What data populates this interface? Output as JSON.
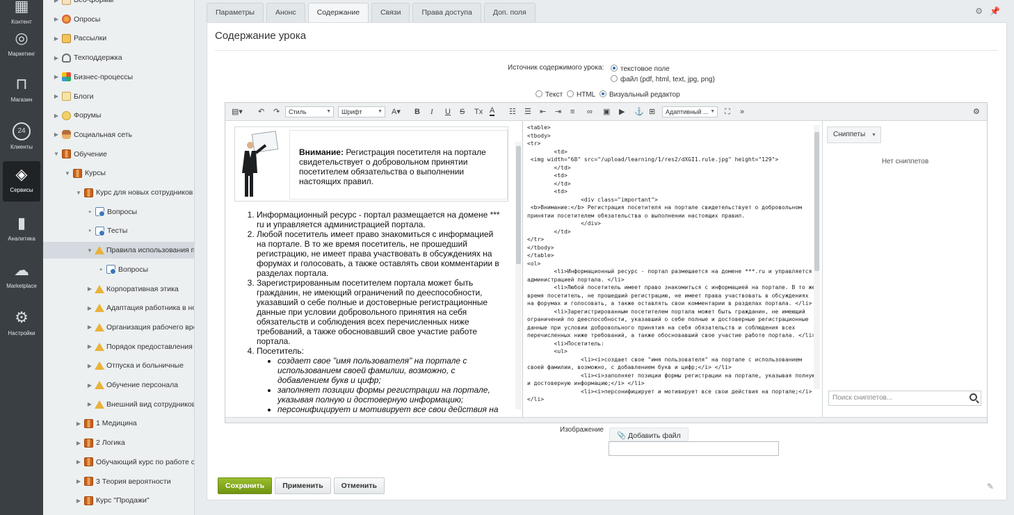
{
  "rail": [
    {
      "label": "Контент",
      "icon": "content-icon"
    },
    {
      "label": "Маркетинг",
      "icon": "target-icon"
    },
    {
      "label": "Магазин",
      "icon": "basket-icon"
    },
    {
      "label": "Клиенты",
      "icon": "clients-icon",
      "badge": "24"
    },
    {
      "label": "Сервисы",
      "icon": "layers-icon",
      "active": true
    },
    {
      "label": "Аналитика",
      "icon": "bar-chart-icon"
    },
    {
      "label": "Marketplace",
      "icon": "cloud-download-icon"
    },
    {
      "label": "Настройки",
      "icon": "gear-icon"
    }
  ],
  "tree": [
    {
      "label": "Веб-формы",
      "icon": "web",
      "level": 0
    },
    {
      "label": "Опросы",
      "icon": "round",
      "level": 0
    },
    {
      "label": "Рассылки",
      "icon": "env",
      "level": 0
    },
    {
      "label": "Техподдержка",
      "icon": "head",
      "level": 0
    },
    {
      "label": "Бизнес-процессы",
      "icon": "biz",
      "level": 0
    },
    {
      "label": "Блоги",
      "icon": "blog",
      "level": 0
    },
    {
      "label": "Форумы",
      "icon": "forum",
      "level": 0
    },
    {
      "label": "Социальная сеть",
      "icon": "social",
      "level": 0
    },
    {
      "label": "Обучение",
      "icon": "book",
      "level": 0,
      "open": true
    },
    {
      "label": "Курсы",
      "icon": "book",
      "level": 1,
      "open": true
    },
    {
      "label": "Курс для новых сотрудников",
      "icon": "book",
      "level": 2,
      "open": true
    },
    {
      "label": "Вопросы",
      "icon": "q",
      "level": 3,
      "leaf": true
    },
    {
      "label": "Тесты",
      "icon": "q",
      "level": 3,
      "leaf": true
    },
    {
      "label": "Правила использования портала",
      "icon": "warn",
      "level": 3,
      "open": true,
      "selected": true
    },
    {
      "label": "Вопросы",
      "icon": "q",
      "level": 4,
      "leaf": true
    },
    {
      "label": "Корпоративная этика",
      "icon": "warn",
      "level": 3
    },
    {
      "label": "Адаптация работника в новом коллективе",
      "icon": "warn",
      "level": 3
    },
    {
      "label": "Организация рабочего времени",
      "icon": "warn",
      "level": 3
    },
    {
      "label": "Порядок предоставления отпусков",
      "icon": "warn",
      "level": 3
    },
    {
      "label": "Отпуска и больничные",
      "icon": "warn",
      "level": 3
    },
    {
      "label": "Обучение персонала",
      "icon": "warn",
      "level": 3
    },
    {
      "label": "Внешний вид сотрудников",
      "icon": "warn",
      "level": 3
    },
    {
      "label": "1 Медицина",
      "icon": "book",
      "level": 2
    },
    {
      "label": "2 Логика",
      "icon": "book",
      "level": 2
    },
    {
      "label": "Обучающий курс по работе с порталом",
      "icon": "book",
      "level": 2
    },
    {
      "label": "3 Теория вероятности",
      "icon": "book",
      "level": 2
    },
    {
      "label": "Курс \"Продажи\"",
      "icon": "book",
      "level": 2
    }
  ],
  "tabs": [
    "Параметры",
    "Анонс",
    "Содержание",
    "Связи",
    "Права доступа",
    "Доп. поля"
  ],
  "active_tab": 2,
  "panel": {
    "title": "Содержание урока",
    "source_label": "Источник содержимого урока:",
    "source_opt1": "текстовое поле",
    "source_opt2": "файл (pdf, html, text, jpg, png)",
    "mode_text": "Текст",
    "mode_html": "HTML",
    "mode_visual": "Визуальный редактор",
    "image_label": "Изображение",
    "add_file": "Добавить файл"
  },
  "toolbar": {
    "style": "Стиль",
    "font": "Шрифт",
    "adaptive": "Адаптивный ..."
  },
  "wys": {
    "note_bold": "Внимание:",
    "note_text": " Регистрация посетителя на портале свидетельствует о добровольном принятии посетителем обязательства о выполнении настоящих правил.",
    "li1": "Информационный ресурс - портал размещается на домене *** ru и управляется администрацией портала.",
    "li2": "Любой посетитель имеет право знакомиться с информацией на портале. В то же время посетитель, не прошедший регистрацию, не имеет права участвовать в обсуждениях на форумах и голосовать, а также оставлять свои комментарии в разделах портала.",
    "li3": "Зарегистрированным посетителем портала может быть гражданин, не имеющий ограничений по дееспособности, указавший о себе полные и достоверные регистрационные данные при условии добровольного принятия на себя обязательств и соблюдения всех перечисленных ниже требований, а также обосновавший свое участие работе портала.",
    "li4": "Посетитель:",
    "sub1": "создает свое \"имя пользователя\" на портале с использованием своей фамилии, возможно, с добавлением букв и цифр;",
    "sub2": "заполняет позиции формы регистрации на портале, указывая полную и достоверную информацию;",
    "sub3": "персонифицирует и мотивирует все свои действия на портале;"
  },
  "code": "<table>\n<tbody>\n<tr>\n        <td>\n <img width=\"68\" src=\"/upload/learning/1/res2/dXGI1.rule.jpg\" height=\"129\">\n        </td>\n        <td>\n        </td>\n        <td>\n                <div class=\"important\">\n <b>Внимание:</b> Регистрация посетителя на портале свидетельствует о добровольном принятии посетителем обязательства о выполнении настоящих правил.\n                </div>\n        </td>\n</tr>\n</tbody>\n</table>\n<ol>\n        <li>Информационный ресурс - портал размещается на домене ***.ru и управляется администрацией портала. </li>\n        <li>Любой посетитель имеет право знакомиться с информацией на портале. В то же время посетитель, не прошедший регистрацию, не имеет права участвовать в обсуждениях на форумах и голосовать, а также оставлять свои комментарии в разделах портала. </li>\n        <li>Зарегистрированным посетителем портала может быть гражданин, не имеющий ограничений по дееспособности, указавший о себе полные и достоверные регистрационные данные при условии добровольного принятия на себя обязательств и соблюдения всех перечисленных ниже требований, а также обосновавший свое участие работе портала. </li>\n        <li>Посетитель:\n        <ul>\n                <li><i>создает свое \"имя пользователя\" на портале с использованием своей фамилии, возможно, с добавлением букв и цифр;</i> </li>\n                <li><i>заполняет позиции формы регистрации на портале, указывая полную и достоверную информацию;</i> </li>\n                <li><i>персонифицирует и мотивирует все свои действия на портале;</i> </li>",
  "snippets": {
    "label": "Сниппеты",
    "empty": "Нет сниппетов",
    "search_placeholder": "Поиск сниппетов..."
  },
  "buttons": {
    "save": "Сохранить",
    "apply": "Применить",
    "cancel": "Отменить"
  },
  "colors": {
    "rail_bg": "#3a3f44",
    "save_green": "#82a81d",
    "radio_blue": "#2f6fb0"
  }
}
